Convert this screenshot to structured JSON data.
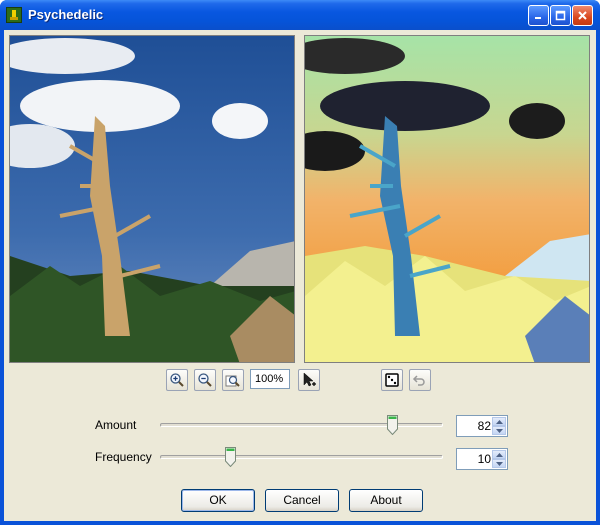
{
  "window": {
    "title": "Psychedelic",
    "app_icon": "tree-icon"
  },
  "title_buttons": {
    "minimize": "minimize-icon",
    "maximize": "maximize-icon",
    "close": "close-icon"
  },
  "toolbar": {
    "zoom_in": "zoom-in-icon",
    "zoom_out": "zoom-out-icon",
    "fit": "zoom-fit-icon",
    "zoom_value": "100%",
    "pointer": "pointer-add-icon",
    "random": "dice-icon",
    "reset": "undo-icon"
  },
  "controls": {
    "amount": {
      "label": "Amount",
      "value": "82",
      "level": 82,
      "max": 100
    },
    "frequency": {
      "label": "Frequency",
      "value": "10",
      "level": 25,
      "max": 100
    }
  },
  "buttons": {
    "ok": "OK",
    "cancel": "Cancel",
    "about": "About"
  },
  "colors": {
    "title_blue": "#0a52d8",
    "face": "#ece9d8",
    "sky_original": "#2b5fa5",
    "sky_effect": "#f4a040"
  }
}
